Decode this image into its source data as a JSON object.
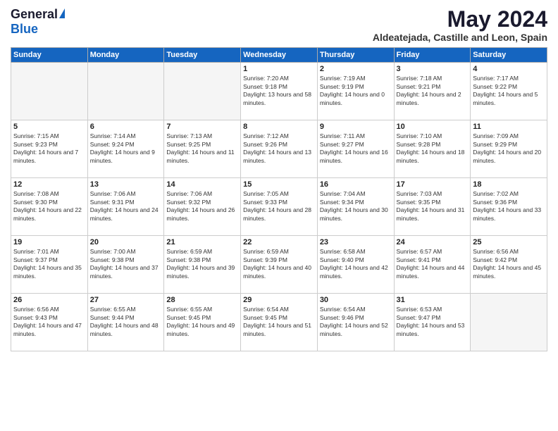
{
  "header": {
    "logo_general": "General",
    "logo_blue": "Blue",
    "month_year": "May 2024",
    "location": "Aldeatejada, Castille and Leon, Spain"
  },
  "weekdays": [
    "Sunday",
    "Monday",
    "Tuesday",
    "Wednesday",
    "Thursday",
    "Friday",
    "Saturday"
  ],
  "weeks": [
    [
      {
        "day": "",
        "sunrise": "",
        "sunset": "",
        "daylight": ""
      },
      {
        "day": "",
        "sunrise": "",
        "sunset": "",
        "daylight": ""
      },
      {
        "day": "",
        "sunrise": "",
        "sunset": "",
        "daylight": ""
      },
      {
        "day": "1",
        "sunrise": "Sunrise: 7:20 AM",
        "sunset": "Sunset: 9:18 PM",
        "daylight": "Daylight: 13 hours and 58 minutes."
      },
      {
        "day": "2",
        "sunrise": "Sunrise: 7:19 AM",
        "sunset": "Sunset: 9:19 PM",
        "daylight": "Daylight: 14 hours and 0 minutes."
      },
      {
        "day": "3",
        "sunrise": "Sunrise: 7:18 AM",
        "sunset": "Sunset: 9:21 PM",
        "daylight": "Daylight: 14 hours and 2 minutes."
      },
      {
        "day": "4",
        "sunrise": "Sunrise: 7:17 AM",
        "sunset": "Sunset: 9:22 PM",
        "daylight": "Daylight: 14 hours and 5 minutes."
      }
    ],
    [
      {
        "day": "5",
        "sunrise": "Sunrise: 7:15 AM",
        "sunset": "Sunset: 9:23 PM",
        "daylight": "Daylight: 14 hours and 7 minutes."
      },
      {
        "day": "6",
        "sunrise": "Sunrise: 7:14 AM",
        "sunset": "Sunset: 9:24 PM",
        "daylight": "Daylight: 14 hours and 9 minutes."
      },
      {
        "day": "7",
        "sunrise": "Sunrise: 7:13 AM",
        "sunset": "Sunset: 9:25 PM",
        "daylight": "Daylight: 14 hours and 11 minutes."
      },
      {
        "day": "8",
        "sunrise": "Sunrise: 7:12 AM",
        "sunset": "Sunset: 9:26 PM",
        "daylight": "Daylight: 14 hours and 13 minutes."
      },
      {
        "day": "9",
        "sunrise": "Sunrise: 7:11 AM",
        "sunset": "Sunset: 9:27 PM",
        "daylight": "Daylight: 14 hours and 16 minutes."
      },
      {
        "day": "10",
        "sunrise": "Sunrise: 7:10 AM",
        "sunset": "Sunset: 9:28 PM",
        "daylight": "Daylight: 14 hours and 18 minutes."
      },
      {
        "day": "11",
        "sunrise": "Sunrise: 7:09 AM",
        "sunset": "Sunset: 9:29 PM",
        "daylight": "Daylight: 14 hours and 20 minutes."
      }
    ],
    [
      {
        "day": "12",
        "sunrise": "Sunrise: 7:08 AM",
        "sunset": "Sunset: 9:30 PM",
        "daylight": "Daylight: 14 hours and 22 minutes."
      },
      {
        "day": "13",
        "sunrise": "Sunrise: 7:06 AM",
        "sunset": "Sunset: 9:31 PM",
        "daylight": "Daylight: 14 hours and 24 minutes."
      },
      {
        "day": "14",
        "sunrise": "Sunrise: 7:06 AM",
        "sunset": "Sunset: 9:32 PM",
        "daylight": "Daylight: 14 hours and 26 minutes."
      },
      {
        "day": "15",
        "sunrise": "Sunrise: 7:05 AM",
        "sunset": "Sunset: 9:33 PM",
        "daylight": "Daylight: 14 hours and 28 minutes."
      },
      {
        "day": "16",
        "sunrise": "Sunrise: 7:04 AM",
        "sunset": "Sunset: 9:34 PM",
        "daylight": "Daylight: 14 hours and 30 minutes."
      },
      {
        "day": "17",
        "sunrise": "Sunrise: 7:03 AM",
        "sunset": "Sunset: 9:35 PM",
        "daylight": "Daylight: 14 hours and 31 minutes."
      },
      {
        "day": "18",
        "sunrise": "Sunrise: 7:02 AM",
        "sunset": "Sunset: 9:36 PM",
        "daylight": "Daylight: 14 hours and 33 minutes."
      }
    ],
    [
      {
        "day": "19",
        "sunrise": "Sunrise: 7:01 AM",
        "sunset": "Sunset: 9:37 PM",
        "daylight": "Daylight: 14 hours and 35 minutes."
      },
      {
        "day": "20",
        "sunrise": "Sunrise: 7:00 AM",
        "sunset": "Sunset: 9:38 PM",
        "daylight": "Daylight: 14 hours and 37 minutes."
      },
      {
        "day": "21",
        "sunrise": "Sunrise: 6:59 AM",
        "sunset": "Sunset: 9:38 PM",
        "daylight": "Daylight: 14 hours and 39 minutes."
      },
      {
        "day": "22",
        "sunrise": "Sunrise: 6:59 AM",
        "sunset": "Sunset: 9:39 PM",
        "daylight": "Daylight: 14 hours and 40 minutes."
      },
      {
        "day": "23",
        "sunrise": "Sunrise: 6:58 AM",
        "sunset": "Sunset: 9:40 PM",
        "daylight": "Daylight: 14 hours and 42 minutes."
      },
      {
        "day": "24",
        "sunrise": "Sunrise: 6:57 AM",
        "sunset": "Sunset: 9:41 PM",
        "daylight": "Daylight: 14 hours and 44 minutes."
      },
      {
        "day": "25",
        "sunrise": "Sunrise: 6:56 AM",
        "sunset": "Sunset: 9:42 PM",
        "daylight": "Daylight: 14 hours and 45 minutes."
      }
    ],
    [
      {
        "day": "26",
        "sunrise": "Sunrise: 6:56 AM",
        "sunset": "Sunset: 9:43 PM",
        "daylight": "Daylight: 14 hours and 47 minutes."
      },
      {
        "day": "27",
        "sunrise": "Sunrise: 6:55 AM",
        "sunset": "Sunset: 9:44 PM",
        "daylight": "Daylight: 14 hours and 48 minutes."
      },
      {
        "day": "28",
        "sunrise": "Sunrise: 6:55 AM",
        "sunset": "Sunset: 9:45 PM",
        "daylight": "Daylight: 14 hours and 49 minutes."
      },
      {
        "day": "29",
        "sunrise": "Sunrise: 6:54 AM",
        "sunset": "Sunset: 9:45 PM",
        "daylight": "Daylight: 14 hours and 51 minutes."
      },
      {
        "day": "30",
        "sunrise": "Sunrise: 6:54 AM",
        "sunset": "Sunset: 9:46 PM",
        "daylight": "Daylight: 14 hours and 52 minutes."
      },
      {
        "day": "31",
        "sunrise": "Sunrise: 6:53 AM",
        "sunset": "Sunset: 9:47 PM",
        "daylight": "Daylight: 14 hours and 53 minutes."
      },
      {
        "day": "",
        "sunrise": "",
        "sunset": "",
        "daylight": ""
      }
    ]
  ]
}
